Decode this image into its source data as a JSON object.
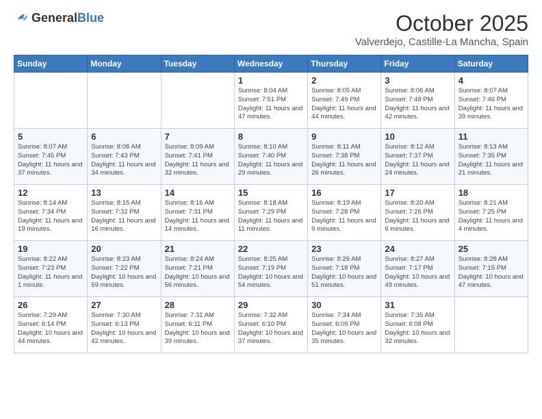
{
  "header": {
    "logo_general": "General",
    "logo_blue": "Blue",
    "month": "October 2025",
    "location": "Valverdejo, Castille-La Mancha, Spain"
  },
  "weekdays": [
    "Sunday",
    "Monday",
    "Tuesday",
    "Wednesday",
    "Thursday",
    "Friday",
    "Saturday"
  ],
  "weeks": [
    [
      {
        "day": "",
        "info": ""
      },
      {
        "day": "",
        "info": ""
      },
      {
        "day": "",
        "info": ""
      },
      {
        "day": "1",
        "info": "Sunrise: 8:04 AM\nSunset: 7:51 PM\nDaylight: 11 hours and 47 minutes."
      },
      {
        "day": "2",
        "info": "Sunrise: 8:05 AM\nSunset: 7:49 PM\nDaylight: 11 hours and 44 minutes."
      },
      {
        "day": "3",
        "info": "Sunrise: 8:06 AM\nSunset: 7:48 PM\nDaylight: 11 hours and 42 minutes."
      },
      {
        "day": "4",
        "info": "Sunrise: 8:07 AM\nSunset: 7:46 PM\nDaylight: 11 hours and 39 minutes."
      }
    ],
    [
      {
        "day": "5",
        "info": "Sunrise: 8:07 AM\nSunset: 7:45 PM\nDaylight: 11 hours and 37 minutes."
      },
      {
        "day": "6",
        "info": "Sunrise: 8:08 AM\nSunset: 7:43 PM\nDaylight: 11 hours and 34 minutes."
      },
      {
        "day": "7",
        "info": "Sunrise: 8:09 AM\nSunset: 7:41 PM\nDaylight: 11 hours and 32 minutes."
      },
      {
        "day": "8",
        "info": "Sunrise: 8:10 AM\nSunset: 7:40 PM\nDaylight: 11 hours and 29 minutes."
      },
      {
        "day": "9",
        "info": "Sunrise: 8:11 AM\nSunset: 7:38 PM\nDaylight: 11 hours and 26 minutes."
      },
      {
        "day": "10",
        "info": "Sunrise: 8:12 AM\nSunset: 7:37 PM\nDaylight: 11 hours and 24 minutes."
      },
      {
        "day": "11",
        "info": "Sunrise: 8:13 AM\nSunset: 7:35 PM\nDaylight: 11 hours and 21 minutes."
      }
    ],
    [
      {
        "day": "12",
        "info": "Sunrise: 8:14 AM\nSunset: 7:34 PM\nDaylight: 11 hours and 19 minutes."
      },
      {
        "day": "13",
        "info": "Sunrise: 8:15 AM\nSunset: 7:32 PM\nDaylight: 11 hours and 16 minutes."
      },
      {
        "day": "14",
        "info": "Sunrise: 8:16 AM\nSunset: 7:31 PM\nDaylight: 11 hours and 14 minutes."
      },
      {
        "day": "15",
        "info": "Sunrise: 8:18 AM\nSunset: 7:29 PM\nDaylight: 11 hours and 11 minutes."
      },
      {
        "day": "16",
        "info": "Sunrise: 8:19 AM\nSunset: 7:28 PM\nDaylight: 11 hours and 9 minutes."
      },
      {
        "day": "17",
        "info": "Sunrise: 8:20 AM\nSunset: 7:26 PM\nDaylight: 11 hours and 6 minutes."
      },
      {
        "day": "18",
        "info": "Sunrise: 8:21 AM\nSunset: 7:25 PM\nDaylight: 11 hours and 4 minutes."
      }
    ],
    [
      {
        "day": "19",
        "info": "Sunrise: 8:22 AM\nSunset: 7:23 PM\nDaylight: 11 hours and 1 minute."
      },
      {
        "day": "20",
        "info": "Sunrise: 8:23 AM\nSunset: 7:22 PM\nDaylight: 10 hours and 59 minutes."
      },
      {
        "day": "21",
        "info": "Sunrise: 8:24 AM\nSunset: 7:21 PM\nDaylight: 10 hours and 56 minutes."
      },
      {
        "day": "22",
        "info": "Sunrise: 8:25 AM\nSunset: 7:19 PM\nDaylight: 10 hours and 54 minutes."
      },
      {
        "day": "23",
        "info": "Sunrise: 8:26 AM\nSunset: 7:18 PM\nDaylight: 10 hours and 51 minutes."
      },
      {
        "day": "24",
        "info": "Sunrise: 8:27 AM\nSunset: 7:17 PM\nDaylight: 10 hours and 49 minutes."
      },
      {
        "day": "25",
        "info": "Sunrise: 8:28 AM\nSunset: 7:15 PM\nDaylight: 10 hours and 47 minutes."
      }
    ],
    [
      {
        "day": "26",
        "info": "Sunrise: 7:29 AM\nSunset: 6:14 PM\nDaylight: 10 hours and 44 minutes."
      },
      {
        "day": "27",
        "info": "Sunrise: 7:30 AM\nSunset: 6:13 PM\nDaylight: 10 hours and 42 minutes."
      },
      {
        "day": "28",
        "info": "Sunrise: 7:31 AM\nSunset: 6:11 PM\nDaylight: 10 hours and 39 minutes."
      },
      {
        "day": "29",
        "info": "Sunrise: 7:32 AM\nSunset: 6:10 PM\nDaylight: 10 hours and 37 minutes."
      },
      {
        "day": "30",
        "info": "Sunrise: 7:34 AM\nSunset: 6:09 PM\nDaylight: 10 hours and 35 minutes."
      },
      {
        "day": "31",
        "info": "Sunrise: 7:35 AM\nSunset: 6:08 PM\nDaylight: 10 hours and 32 minutes."
      },
      {
        "day": "",
        "info": ""
      }
    ]
  ]
}
